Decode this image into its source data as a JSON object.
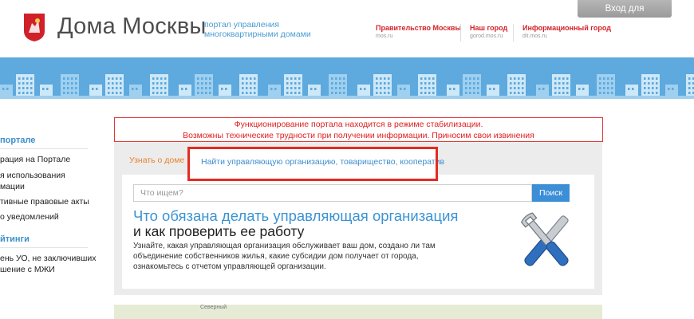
{
  "header": {
    "login_label": "Вход для организаций",
    "logo_title": "Дома Москвы",
    "logo_sub_1": "портал управления",
    "logo_sub_2": "многоквартирными домами",
    "links": [
      {
        "title": "Правительство Москвы",
        "sub": "mos.ru"
      },
      {
        "title": "Наш город",
        "sub": "gorod.mos.ru"
      },
      {
        "title": "Информационный город",
        "sub": "dit.mos.ru"
      }
    ]
  },
  "sidebar": {
    "section1": "портале",
    "items1": [
      "рация на Портале",
      "я использования",
      "мации",
      "тивные правовые акты",
      "о уведомлений"
    ],
    "section2": "йтинги",
    "items2": [
      "ень УО, не заключивших",
      "шение с МЖИ"
    ]
  },
  "notice": {
    "line1": "Функционирование портала находится в режиме стабилизации.",
    "line2": "Возможны технические трудности при получении информации. Приносим свои извинения"
  },
  "tabs": {
    "tab1": "Узнать о доме",
    "tab2": "Найти управляющую организацию, товарищество, кооператив"
  },
  "search": {
    "placeholder": "Что ищем?",
    "button": "Поиск"
  },
  "promo": {
    "title_1": "Что обязана делать управляющая организация",
    "title_2": "и как проверить ее работу",
    "desc_1": "Узнайте, какая управляющая организация обслуживает ваш дом, создано ли там",
    "desc_2": "объединение собственников жилья, какие субсидии дом получает от города,",
    "desc_3": "ознакомьтесь с отчетом управляющей организации."
  },
  "map": {
    "label": "Северный"
  },
  "colors": {
    "accent": "#3c8ed6",
    "notice_red": "#e02020",
    "tab_orange": "#e8822a",
    "brand_red": "#d2232a"
  }
}
